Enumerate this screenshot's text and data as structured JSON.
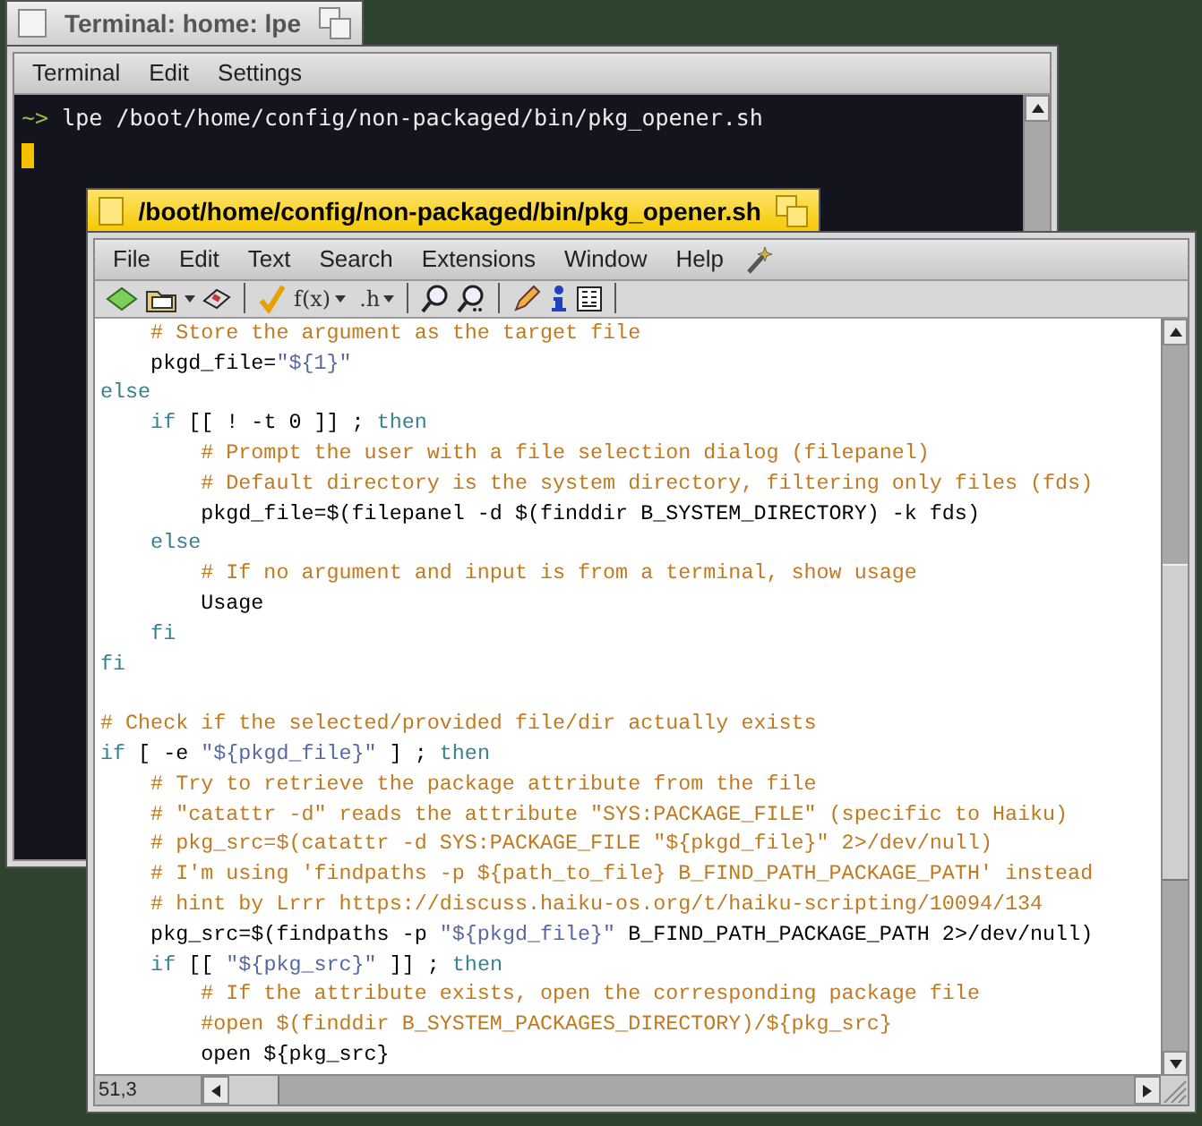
{
  "terminal": {
    "title": "Terminal: home: lpe",
    "focused": false,
    "menu": [
      "Terminal",
      "Edit",
      "Settings"
    ],
    "prompt": "~>",
    "command": " lpe /boot/home/config/non-packaged/bin/pkg_opener.sh"
  },
  "editor": {
    "title": "/boot/home/config/non-packaged/bin/pkg_opener.sh",
    "focused": true,
    "menu": [
      "File",
      "Edit",
      "Text",
      "Search",
      "Extensions",
      "Window",
      "Help"
    ],
    "function_menu": "f(x)",
    "header_menu": ".h",
    "lines": [
      {
        "segments": [
          {
            "kind": "comment",
            "text": "    # Store the argument as the target file"
          }
        ]
      },
      {
        "segments": [
          {
            "kind": "plain",
            "text": "    pkgd_file="
          },
          {
            "kind": "string",
            "text": "\"${1}\""
          }
        ]
      },
      {
        "segments": [
          {
            "kind": "keyword",
            "text": "else"
          }
        ]
      },
      {
        "segments": [
          {
            "kind": "keyword",
            "text": "    if"
          },
          {
            "kind": "plain",
            "text": " [[ ! -t 0 ]] ; "
          },
          {
            "kind": "keyword",
            "text": "then"
          }
        ]
      },
      {
        "segments": [
          {
            "kind": "comment",
            "text": "        # Prompt the user with a file selection dialog (filepanel)"
          }
        ]
      },
      {
        "segments": [
          {
            "kind": "comment",
            "text": "        # Default directory is the system directory, filtering only files (fds)"
          }
        ]
      },
      {
        "segments": [
          {
            "kind": "plain",
            "text": "        pkgd_file=$(filepanel -d $(finddir B_SYSTEM_DIRECTORY) -k fds)"
          }
        ]
      },
      {
        "segments": [
          {
            "kind": "keyword",
            "text": "    else"
          }
        ]
      },
      {
        "segments": [
          {
            "kind": "comment",
            "text": "        # If no argument and input is from a terminal, show usage"
          }
        ]
      },
      {
        "segments": [
          {
            "kind": "plain",
            "text": "        Usage"
          }
        ]
      },
      {
        "segments": [
          {
            "kind": "keyword",
            "text": "    fi"
          }
        ]
      },
      {
        "segments": [
          {
            "kind": "keyword",
            "text": "fi"
          }
        ]
      },
      {
        "kind": "blank"
      },
      {
        "segments": [
          {
            "kind": "comment",
            "text": "# Check if the selected/provided file/dir actually exists"
          }
        ]
      },
      {
        "segments": [
          {
            "kind": "keyword",
            "text": "if"
          },
          {
            "kind": "plain",
            "text": " [ -e "
          },
          {
            "kind": "string",
            "text": "\"${pkgd_file}\""
          },
          {
            "kind": "plain",
            "text": " ] ; "
          },
          {
            "kind": "keyword",
            "text": "then"
          }
        ]
      },
      {
        "segments": [
          {
            "kind": "comment",
            "text": "    # Try to retrieve the package attribute from the file"
          }
        ]
      },
      {
        "segments": [
          {
            "kind": "comment",
            "text": "    # \"catattr -d\" reads the attribute \"SYS:PACKAGE_FILE\" (specific to Haiku)"
          }
        ]
      },
      {
        "segments": [
          {
            "kind": "comment",
            "text": "    # pkg_src=$(catattr -d SYS:PACKAGE_FILE \"${pkgd_file}\" 2>/dev/null)"
          }
        ]
      },
      {
        "segments": [
          {
            "kind": "comment",
            "text": "    # I'm using 'findpaths -p ${path_to_file} B_FIND_PATH_PACKAGE_PATH' instead"
          }
        ]
      },
      {
        "segments": [
          {
            "kind": "comment",
            "text": "    # hint by Lrrr https://discuss.haiku-os.org/t/haiku-scripting/10094/134"
          }
        ]
      },
      {
        "segments": [
          {
            "kind": "plain",
            "text": "    pkg_src=$(findpaths -p "
          },
          {
            "kind": "string",
            "text": "\"${pkgd_file}\""
          },
          {
            "kind": "plain",
            "text": " B_FIND_PATH_PACKAGE_PATH 2>/dev/null)"
          }
        ]
      },
      {
        "segments": [
          {
            "kind": "keyword",
            "text": "    if"
          },
          {
            "kind": "plain",
            "text": " [[ "
          },
          {
            "kind": "string",
            "text": "\"${pkg_src}\""
          },
          {
            "kind": "plain",
            "text": " ]] ; "
          },
          {
            "kind": "keyword",
            "text": "then"
          }
        ]
      },
      {
        "segments": [
          {
            "kind": "comment",
            "text": "        # If the attribute exists, open the corresponding package file"
          }
        ]
      },
      {
        "segments": [
          {
            "kind": "comment",
            "text": "        #open $(finddir B_SYSTEM_PACKAGES_DIRECTORY)/${pkg_src}"
          }
        ]
      },
      {
        "segments": [
          {
            "kind": "plain",
            "text": "        open ${pkg_src}"
          }
        ]
      }
    ],
    "status": "51,3"
  }
}
